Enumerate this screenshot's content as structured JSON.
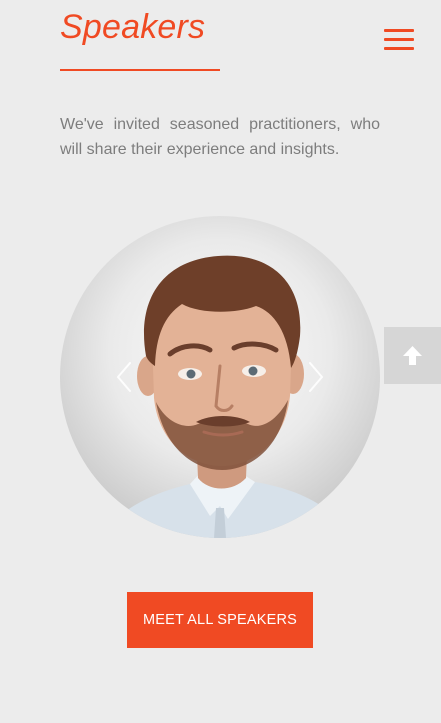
{
  "section": {
    "title": "Speakers",
    "intro": "We've invited seasoned practitioners, who will share their experience and insights."
  },
  "header": {
    "menu_icon": "hamburger-menu-icon"
  },
  "carousel": {
    "prev_icon": "chevron-left-icon",
    "next_icon": "chevron-right-icon",
    "image": "speaker-photo"
  },
  "scroll_top": {
    "icon": "arrow-up-icon"
  },
  "cta": {
    "label": "MEET ALL SPEAKERS"
  },
  "colors": {
    "accent": "#f04a23",
    "background": "#ececec",
    "body_text": "#7d7d7d",
    "scroll_button_bg": "#d6d6d6"
  }
}
